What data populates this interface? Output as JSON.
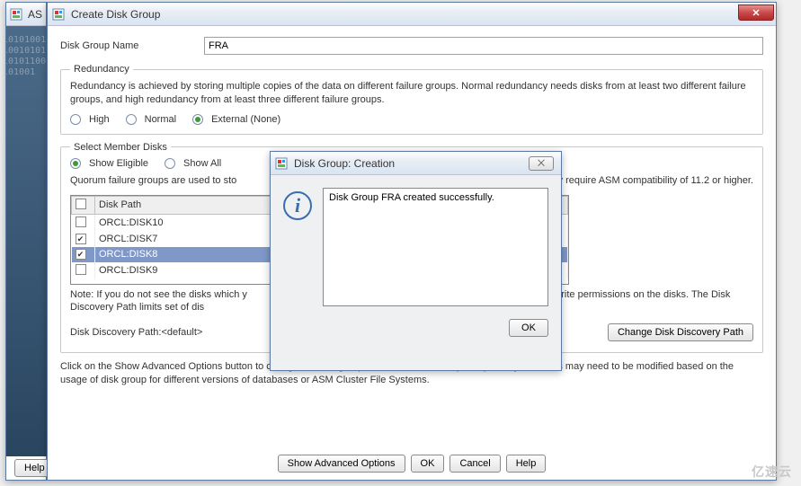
{
  "outer": {
    "title_fragment": "AS",
    "help": "Help"
  },
  "window": {
    "title": "Create Disk Group",
    "close_glyph": "✕"
  },
  "form": {
    "name_label": "Disk Group Name",
    "name_value": "FRA"
  },
  "redundancy": {
    "legend": "Redundancy",
    "desc": "Redundancy is achieved by storing multiple copies of the data on different failure groups. Normal redundancy needs disks from at least two different failure groups, and high redundancy from at least three different failure groups.",
    "options": [
      {
        "label": "High",
        "selected": false
      },
      {
        "label": "Normal",
        "selected": false
      },
      {
        "label": "External (None)",
        "selected": true
      }
    ]
  },
  "members": {
    "legend": "Select Member Disks",
    "view": [
      {
        "label": "Show Eligible",
        "selected": true
      },
      {
        "label": "Show All",
        "selected": false
      }
    ],
    "quorum_visible_left": "Quorum failure groups are used to sto",
    "quorum_visible_right": "r data. They require ASM compatibility of 11.2 or higher.",
    "col_header": "Disk Path",
    "rows": [
      {
        "path": "ORCL:DISK10",
        "checked": false,
        "selected": false
      },
      {
        "path": "ORCL:DISK7",
        "checked": true,
        "selected": false
      },
      {
        "path": "ORCL:DISK8",
        "checked": true,
        "selected": true
      },
      {
        "path": "ORCL:DISK9",
        "checked": false,
        "selected": false
      }
    ],
    "note_left": "Note: If you do not see the disks which y",
    "note_right": "ad/write permissions on the disks. The Disk Discovery Path limits set of dis"
  },
  "discovery": {
    "label": "Disk Discovery Path:<default>",
    "button": "Change Disk Discovery Path"
  },
  "hint": "Click on the Show Advanced Options button to change the disk group attributes. Disk Group compatibility attributes may need to be modified based on the usage of disk group for different versions of databases or ASM Cluster File Systems.",
  "buttons": {
    "advanced": "Show Advanced Options",
    "ok": "OK",
    "cancel": "Cancel",
    "help": "Help"
  },
  "dialog": {
    "title": "Disk Group: Creation",
    "message": "Disk Group FRA created successfully.",
    "ok": "OK",
    "close_glyph": "⨉"
  },
  "watermark": "亿速云"
}
